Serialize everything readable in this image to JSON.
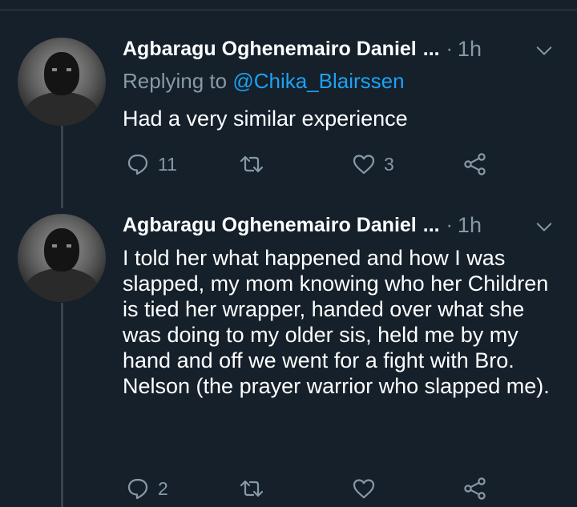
{
  "tweets": [
    {
      "author": "Agbaragu Oghenemairo Daniel",
      "ellipsis": "...",
      "separator": "·",
      "time": "1h",
      "replying_prefix": "Replying to",
      "replying_handle": "@Chika_Blairssen",
      "text": "Had a very similar experience",
      "reply_count": "11",
      "retweet_count": "",
      "like_count": "3"
    },
    {
      "author": "Agbaragu Oghenemairo Daniel",
      "ellipsis": "...",
      "separator": "·",
      "time": "1h",
      "text": "I told her what happened and how I was slapped, my mom knowing who her Children is tied her wrapper, handed over what she was doing to my older sis, held me by my hand and off we went for a fight with Bro. Nelson (the prayer warrior who slapped me).",
      "reply_count": "2",
      "retweet_count": "",
      "like_count": ""
    }
  ],
  "icons": {
    "reply": "reply-icon",
    "retweet": "retweet-icon",
    "like": "heart-icon",
    "share": "share-icon",
    "menu": "chevron-down-icon"
  },
  "colors": {
    "background": "#15202b",
    "secondary_text": "#8899a6",
    "link": "#1da1f2",
    "divider": "#38444d"
  }
}
